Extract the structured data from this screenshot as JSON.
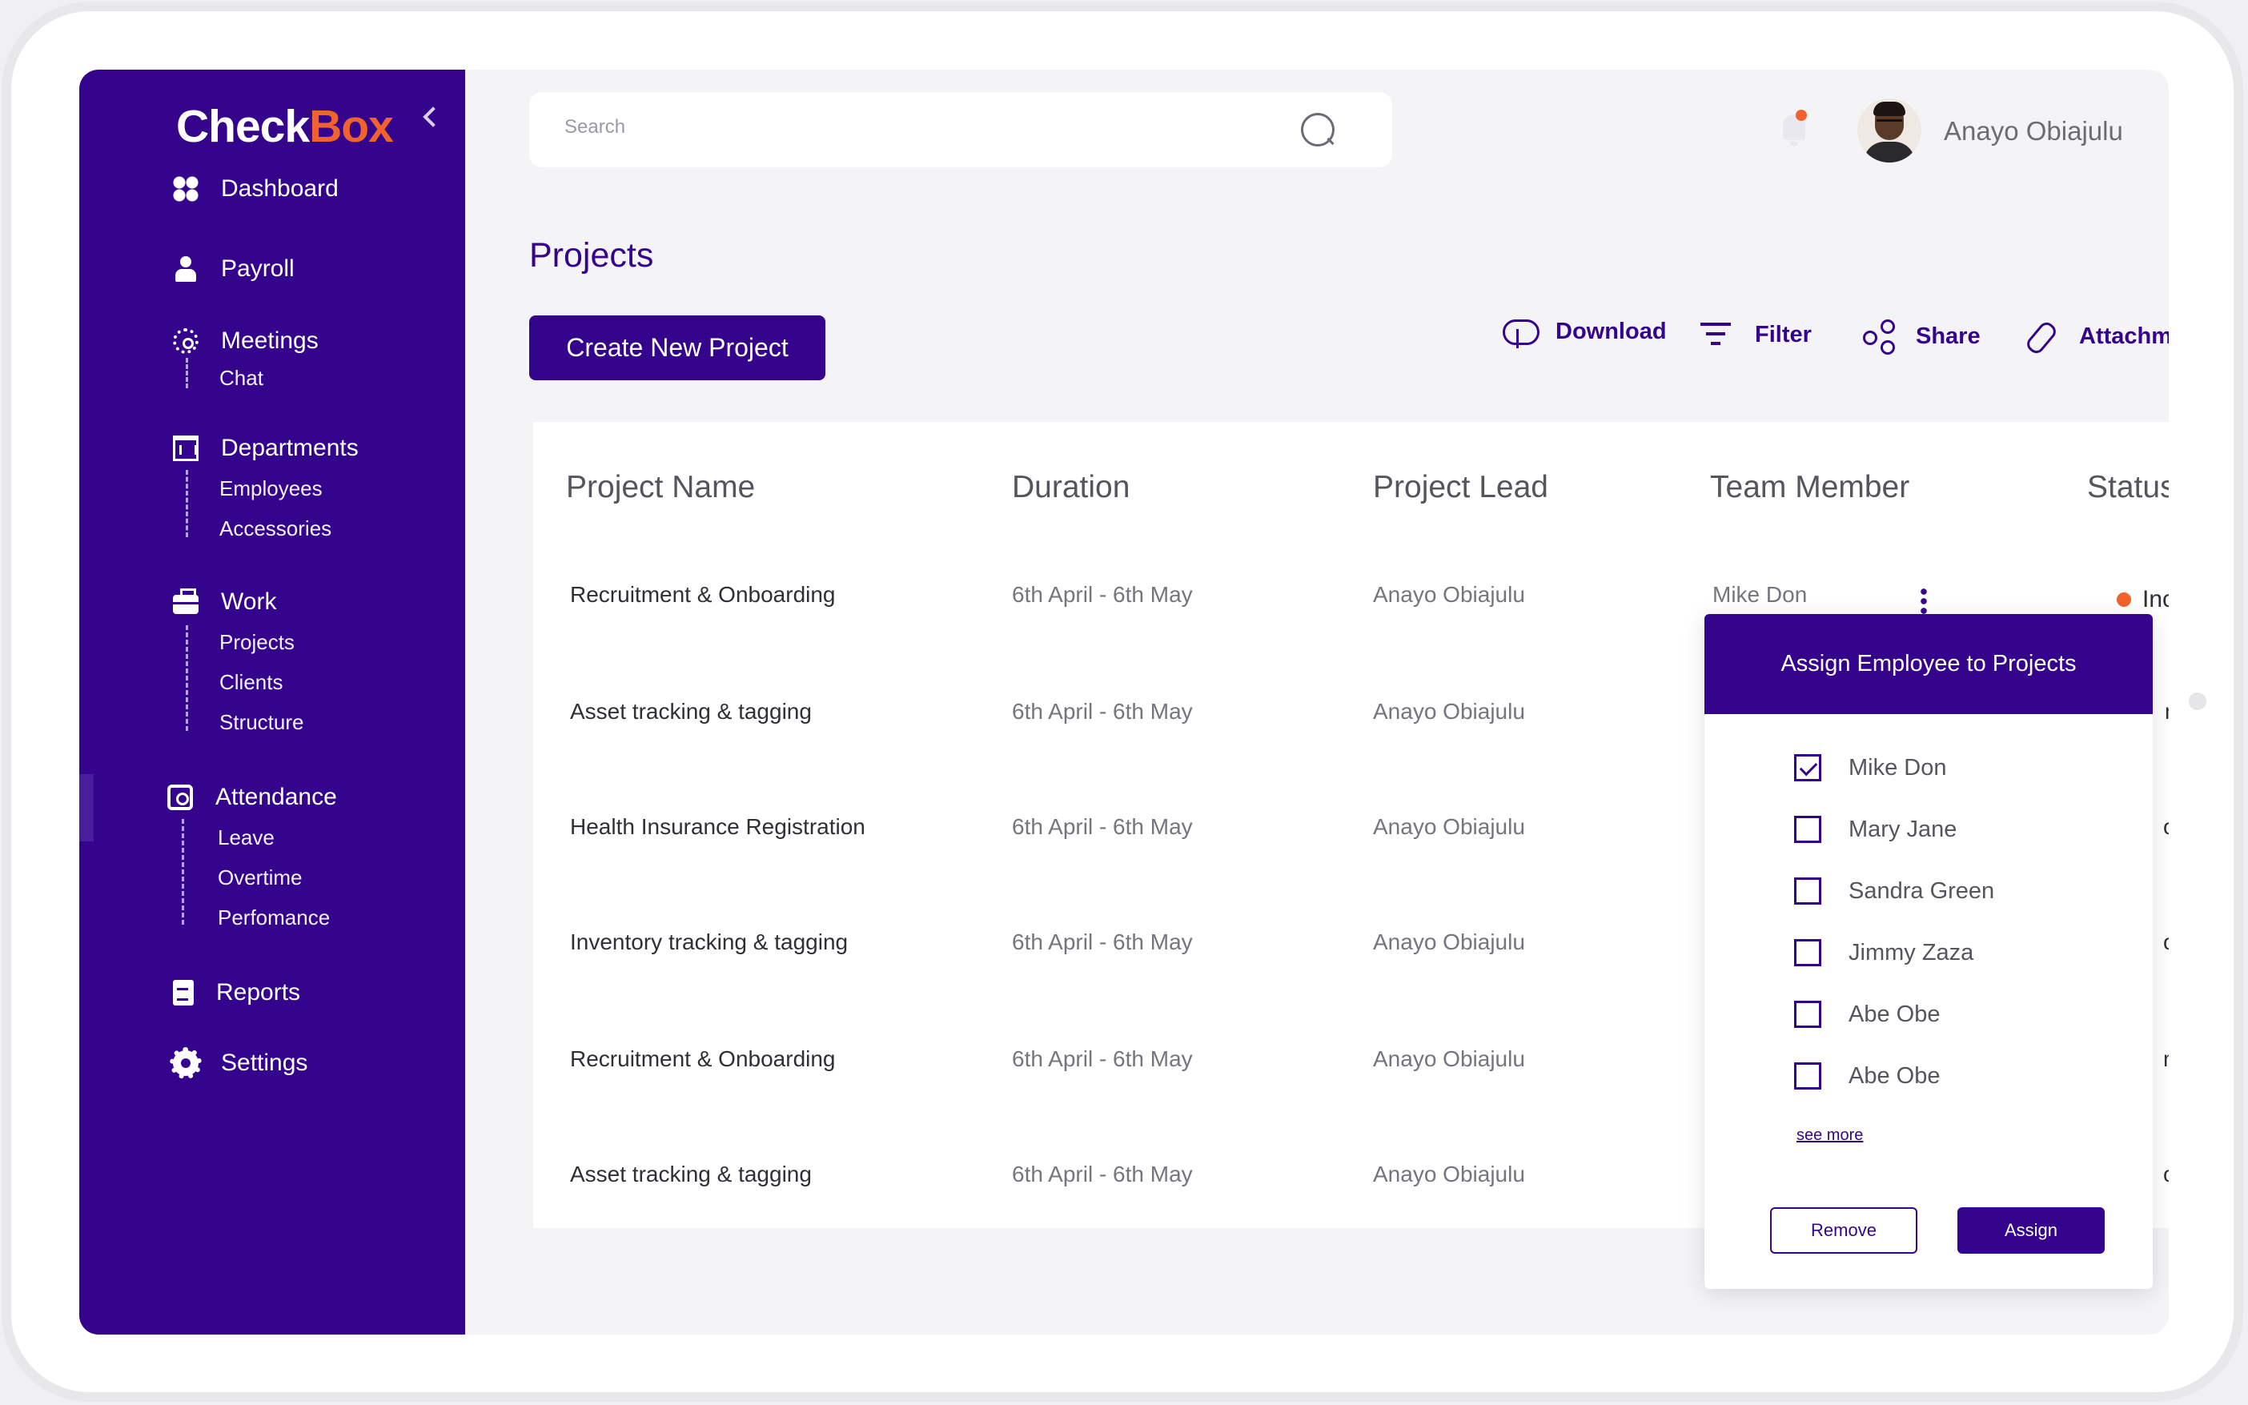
{
  "brand": {
    "logo_part1": "Check",
    "logo_part2": "Box",
    "accent": "#35048c",
    "orange": "#f2622d"
  },
  "sidebar": {
    "items": [
      {
        "label": "Dashboard",
        "icon": "dashboard-icon"
      },
      {
        "label": "Payroll",
        "icon": "payroll-icon"
      },
      {
        "label": "Meetings",
        "icon": "meetings-icon",
        "sub": [
          "Chat"
        ]
      },
      {
        "label": "Departments",
        "icon": "departments-icon",
        "sub": [
          "Employees",
          "Accessories"
        ]
      },
      {
        "label": "Work",
        "icon": "briefcase-icon",
        "sub": [
          "Projects",
          "Clients",
          "Structure"
        ]
      },
      {
        "label": "Attendance",
        "icon": "attendance-icon",
        "sub": [
          "Leave",
          "Overtime",
          "Perfomance"
        ]
      },
      {
        "label": "Reports",
        "icon": "reports-icon"
      },
      {
        "label": "Settings",
        "icon": "settings-icon"
      }
    ]
  },
  "header": {
    "search_placeholder": "Search",
    "user_name": "Anayo Obiajulu"
  },
  "main": {
    "title": "Projects",
    "create_button": "Create New Project",
    "actions": [
      "Download",
      "Filter",
      "Share",
      "Attachm"
    ]
  },
  "table": {
    "headers": [
      "Project Name",
      "Duration",
      "Project Lead",
      "Team Member",
      "Status"
    ],
    "rows": [
      {
        "name": "Recruitment & Onboarding",
        "duration": "6th April - 6th May",
        "lead": "Anayo Obiajulu"
      },
      {
        "name": "Asset tracking & tagging",
        "duration": "6th April - 6th May",
        "lead": "Anayo Obiajulu"
      },
      {
        "name": "Health Insurance Registration",
        "duration": "6th April - 6th May",
        "lead": "Anayo Obiajulu"
      },
      {
        "name": "Inventory tracking & tagging",
        "duration": "6th April - 6th May",
        "lead": "Anayo Obiajulu"
      },
      {
        "name": "Recruitment & Onboarding",
        "duration": "6th April - 6th May",
        "lead": "Anayo Obiajulu"
      },
      {
        "name": "Asset tracking & tagging",
        "duration": "6th April - 6th May",
        "lead": "Anayo Obiajulu"
      }
    ],
    "first_team_member": "Mike Don",
    "first_status": "Incor",
    "hidden_status_fragments": [
      "m",
      "or",
      "or",
      "m",
      "or"
    ]
  },
  "popup": {
    "title": "Assign Employee to Projects",
    "options": [
      {
        "label": "Mike Don",
        "checked": true
      },
      {
        "label": "Mary Jane",
        "checked": false
      },
      {
        "label": "Sandra Green",
        "checked": false
      },
      {
        "label": "Jimmy Zaza",
        "checked": false
      },
      {
        "label": "Abe Obe",
        "checked": false
      },
      {
        "label": "Abe Obe",
        "checked": false
      }
    ],
    "see_more": "see more",
    "remove_label": "Remove",
    "assign_label": "Assign"
  }
}
